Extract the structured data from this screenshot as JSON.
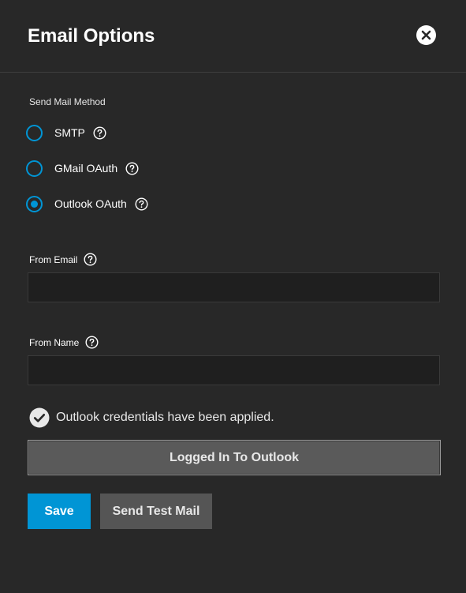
{
  "dialog": {
    "title": "Email Options",
    "close_icon": "close-icon"
  },
  "send_method": {
    "label": "Send Mail Method",
    "options": [
      {
        "label": "SMTP",
        "checked": false
      },
      {
        "label": "GMail OAuth",
        "checked": false
      },
      {
        "label": "Outlook OAuth",
        "checked": true
      }
    ]
  },
  "fields": {
    "from_email": {
      "label": "From Email",
      "value": ""
    },
    "from_name": {
      "label": "From Name",
      "value": ""
    }
  },
  "status": {
    "icon": "check-circle-icon",
    "text": "Outlook credentials have been applied."
  },
  "buttons": {
    "logged_in": "Logged In To Outlook",
    "save": "Save",
    "send_test": "Send Test Mail"
  },
  "colors": {
    "accent": "#0095d5",
    "background": "#282828",
    "input_bg": "#1f1f1f"
  }
}
